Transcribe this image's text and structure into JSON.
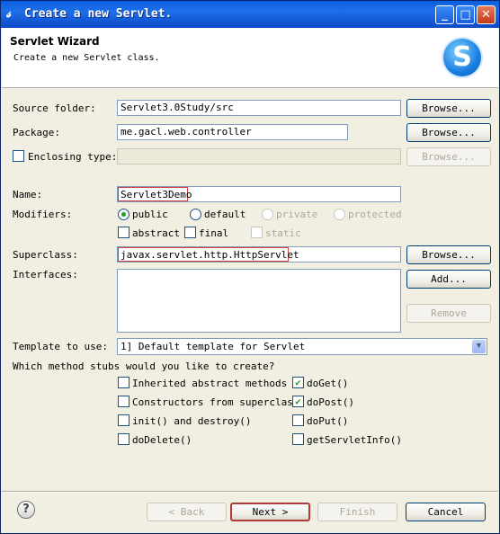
{
  "window": {
    "title": "Create a new Servlet.",
    "icon": "eclipse-icon",
    "controls": {
      "minimize": "_",
      "maximize": "□",
      "close": "✕"
    }
  },
  "header": {
    "title": "Servlet Wizard",
    "description": "Create a new Servlet class.",
    "logo": "S"
  },
  "form": {
    "source_folder": {
      "label": "Source folder:",
      "value": "Servlet3.0Study/src",
      "browse": "Browse..."
    },
    "package": {
      "label": "Package:",
      "value": "me.gacl.web.controller",
      "browse": "Browse..."
    },
    "enclosing_type": {
      "label": "Enclosing type:",
      "value": "",
      "browse": "Browse...",
      "checked": false
    },
    "name": {
      "label": "Name:",
      "value": "Servlet3Demo"
    },
    "modifiers": {
      "label": "Modifiers:",
      "public": "public",
      "default": "default",
      "private": "private",
      "protected": "protected",
      "abstract": "abstract",
      "final": "final",
      "static": "static",
      "selected": "public"
    },
    "superclass": {
      "label": "Superclass:",
      "value": "javax.servlet.http.HttpServlet",
      "browse": "Browse..."
    },
    "interfaces": {
      "label": "Interfaces:",
      "add": "Add...",
      "remove": "Remove"
    },
    "template": {
      "label": "Template to use:",
      "value": "1] Default template for Servlet"
    },
    "stubs": {
      "question": "Which method stubs would you like to create?",
      "inherited_abstract": {
        "label": "Inherited abstract methods",
        "checked": false
      },
      "constructors": {
        "label": "Constructors from superclass",
        "checked": false
      },
      "init_destroy": {
        "label": "init() and destroy()",
        "checked": false
      },
      "do_delete": {
        "label": "doDelete()",
        "checked": false
      },
      "do_get": {
        "label": "doGet()",
        "checked": true
      },
      "do_post": {
        "label": "doPost()",
        "checked": true
      },
      "do_put": {
        "label": "doPut()",
        "checked": false
      },
      "get_servlet_info": {
        "label": "getServletInfo()",
        "checked": false
      }
    }
  },
  "footer": {
    "help": "?",
    "back": "< Back",
    "next": "Next >",
    "finish": "Finish",
    "cancel": "Cancel"
  },
  "colors": {
    "title_bar": "#1f6fe8",
    "highlight": "#d04040",
    "check": "#21a121"
  }
}
